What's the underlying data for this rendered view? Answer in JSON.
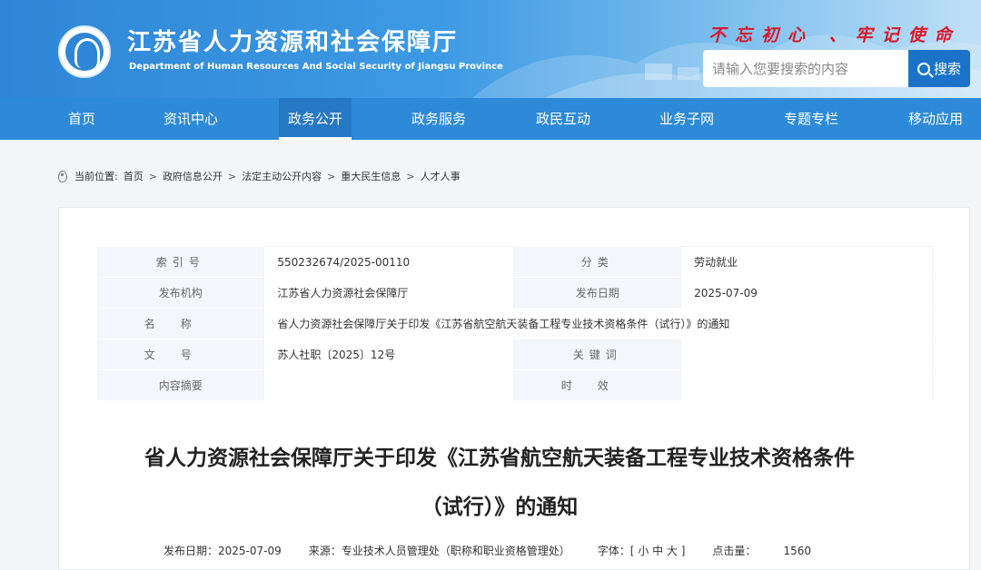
{
  "header": {
    "title": "江苏省人力资源和社会保障厅",
    "subtitle": "Department of Human Resources And Social Security of Jiangsu Province",
    "slogan": "不忘初心 、牢记使命",
    "search": {
      "placeholder": "请输入您要搜索的内容",
      "button_label": "搜索"
    }
  },
  "nav": {
    "items": [
      {
        "label": "首页"
      },
      {
        "label": "资讯中心"
      },
      {
        "label": "政务公开"
      },
      {
        "label": "政务服务"
      },
      {
        "label": "政民互动"
      },
      {
        "label": "业务子网"
      },
      {
        "label": "专题专栏"
      },
      {
        "label": "移动应用"
      }
    ],
    "active": "政务公开"
  },
  "breadcrumb": {
    "prefix": "当前位置:",
    "items": [
      "首页",
      "政府信息公开",
      "法定主动公开内容",
      "重大民生信息",
      "人才人事"
    ],
    "separator": ">"
  },
  "meta_table": {
    "rows": [
      {
        "k1": "索引号",
        "v1": "550232674/2025-00110",
        "k2": "分类",
        "v2": "劳动就业"
      },
      {
        "k1": "发布机构",
        "v1": "江苏省人力资源社会保障厅",
        "k2": "发布日期",
        "v2": "2025-07-09"
      },
      {
        "k1": "名称",
        "v1": "省人力资源社会保障厅关于印发《江苏省航空航天装备工程专业技术资格条件（试行）》的通知"
      },
      {
        "k1": "文号",
        "v1": "苏人社职〔2025〕12号",
        "k2": "关键词",
        "v2": ""
      },
      {
        "k1": "内容摘要",
        "v1": "",
        "k2": "时效",
        "v2": ""
      }
    ]
  },
  "document": {
    "title_line1": "省人力资源社会保障厅关于印发《江苏省航空航天装备工程专业技术资格条件",
    "title_line2": "（试行）》的通知",
    "publish_date_label": "发布日期：",
    "publish_date": "2025-07-09",
    "source_label": "来源：",
    "source": "专业技术人员管理处（职称和职业资格管理处）",
    "font_label": "字体：[ 小 中 大 ]",
    "clicks_label": "点击量：",
    "clicks": "1560"
  },
  "colors": {
    "header_blue": "#2f86d6",
    "nav_blue": "#2d8ad8",
    "slogan_red": "#d7192a"
  }
}
